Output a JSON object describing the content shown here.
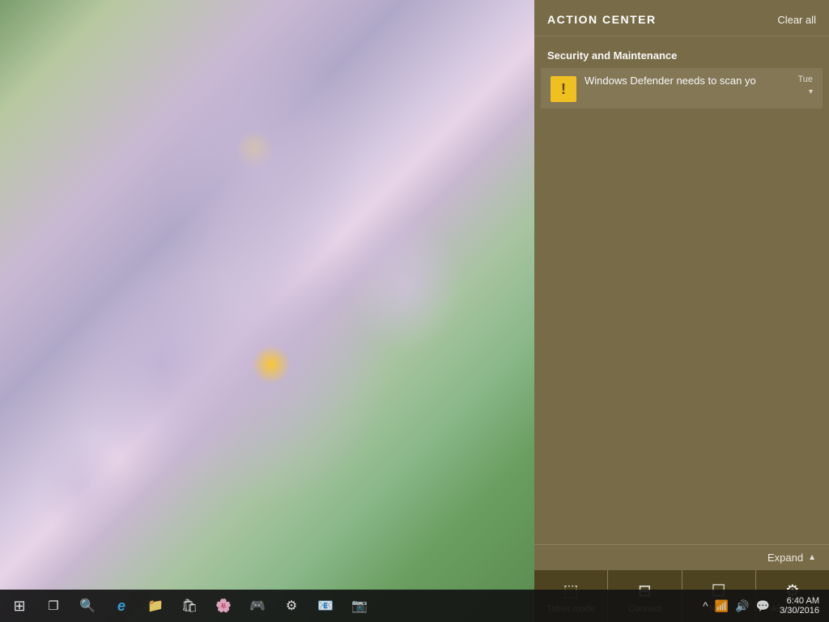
{
  "desktop": {
    "bg_description": "Purple aster flowers on blurred green background"
  },
  "action_center": {
    "title": "ACTION CENTER",
    "clear_all_label": "Clear all",
    "section_header": "Security and Maintenance",
    "notifications": [
      {
        "id": "defender",
        "icon_symbol": "!",
        "text": "Windows Defender needs to scan yo",
        "time": "Tue",
        "has_chevron": true
      }
    ],
    "expand_label": "Expand",
    "quick_actions": [
      {
        "id": "tablet-mode",
        "icon": "⊞",
        "label": "Tablet mode"
      },
      {
        "id": "connect",
        "icon": "⊟",
        "label": "Connect"
      },
      {
        "id": "note",
        "icon": "☐",
        "label": "Note"
      },
      {
        "id": "all-settings",
        "icon": "⚙",
        "label": "All settings"
      }
    ]
  },
  "taskbar": {
    "start_icon": "⊞",
    "task_view_icon": "❐",
    "search_icon": "🔍",
    "edge_icon": "e",
    "explorer_icon": "📁",
    "store_icon": "🛍",
    "buttons": [
      {
        "id": "start",
        "symbol": "⊞"
      },
      {
        "id": "task-view",
        "symbol": "❐"
      },
      {
        "id": "search",
        "symbol": "🔍"
      },
      {
        "id": "edge",
        "symbol": "◑"
      },
      {
        "id": "explorer",
        "symbol": "📁"
      },
      {
        "id": "store",
        "symbol": "🛍"
      },
      {
        "id": "app1",
        "symbol": "🌸"
      },
      {
        "id": "app2",
        "symbol": "🎮"
      },
      {
        "id": "app3",
        "symbol": "⚙"
      },
      {
        "id": "app4",
        "symbol": "📧"
      },
      {
        "id": "app5",
        "symbol": "📷"
      }
    ],
    "tray": {
      "chevron": "^",
      "network_icon": "📶",
      "volume_icon": "🔊",
      "notification_icon": "💬"
    },
    "clock": {
      "time": "6:40 AM",
      "date": "3/30/2016"
    }
  }
}
